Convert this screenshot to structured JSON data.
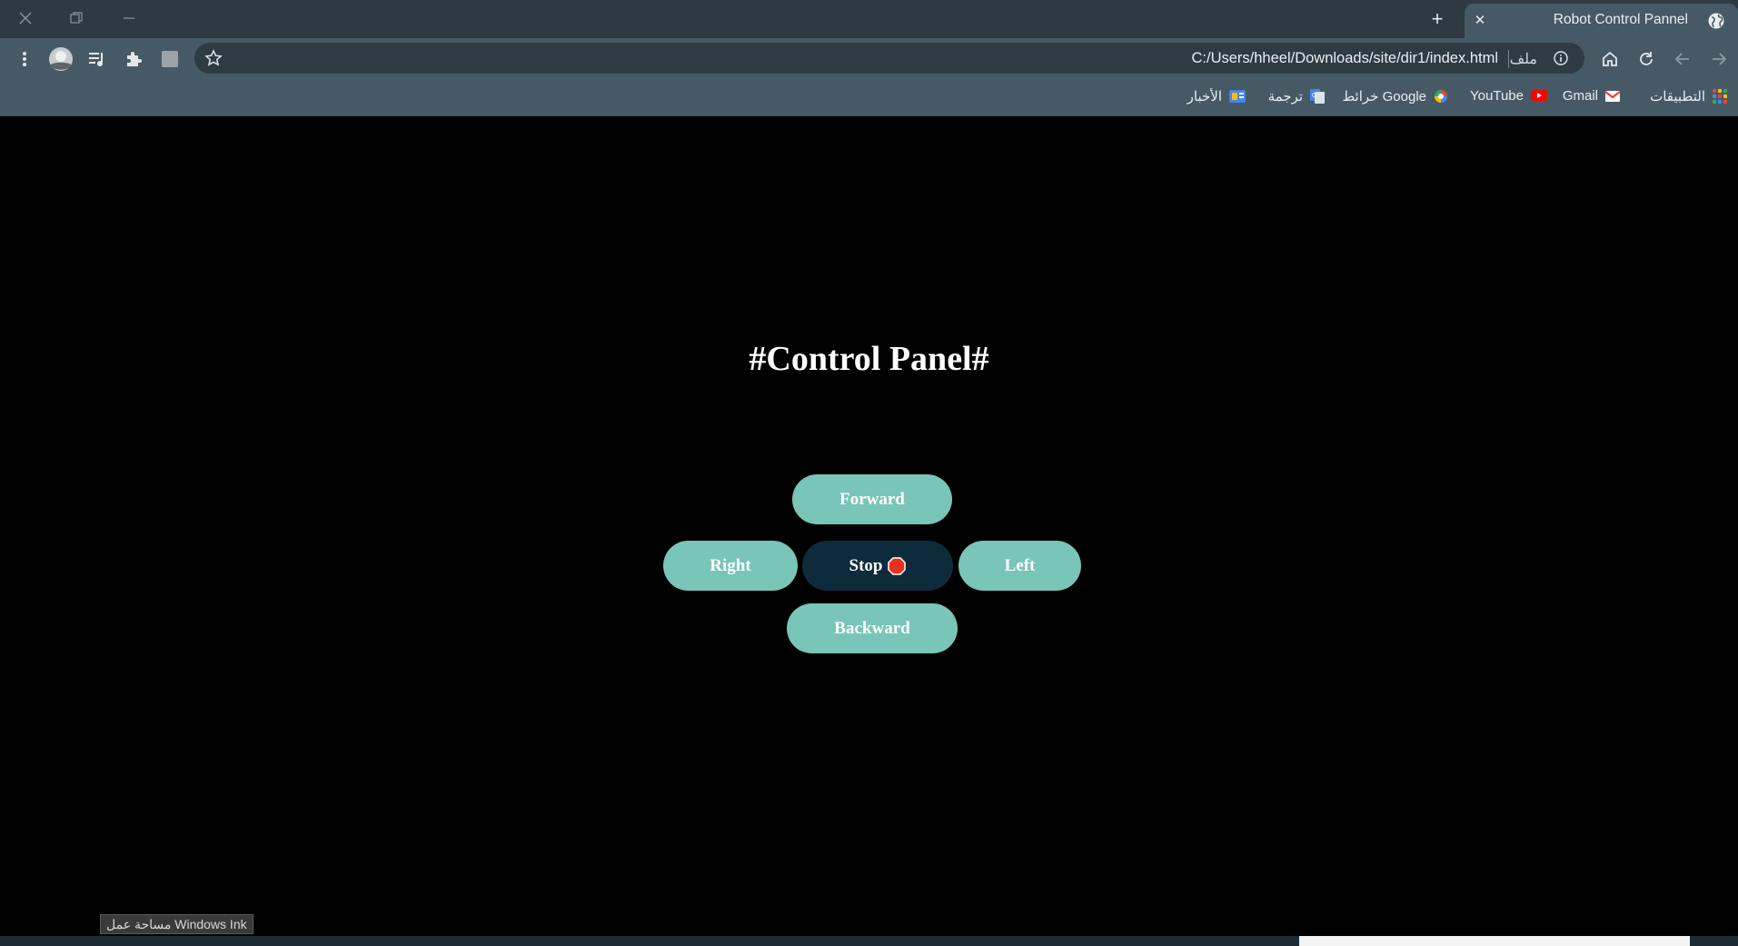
{
  "window": {
    "controls": {
      "close_icon": "close-icon",
      "restore_icon": "restore-icon",
      "minimize_icon": "minimize-icon"
    }
  },
  "tab": {
    "title": "Robot Control Pannel",
    "icon": "globe-icon",
    "close_label": "✕"
  },
  "new_tab": {
    "label": "+"
  },
  "toolbar": {
    "url": "C:/Users/hheel/Downloads/site/dir1/index.html",
    "scheme_label": "ملف",
    "icons": [
      "menu-icon",
      "profile-avatar",
      "media-queue-icon",
      "extensions-icon",
      "extension-app-icon",
      "star-icon",
      "home-icon",
      "reload-icon",
      "back-icon",
      "forward-icon"
    ]
  },
  "bookmarks": [
    {
      "label": "التطبيقات",
      "icon": "apps-grid-icon"
    },
    {
      "label": "Gmail",
      "icon": "gmail-icon"
    },
    {
      "label": "YouTube",
      "icon": "youtube-icon"
    },
    {
      "label": "خرائط Google",
      "icon": "maps-icon"
    },
    {
      "label": "ترجمة",
      "icon": "translate-icon"
    },
    {
      "label": "الأخبار",
      "icon": "news-icon"
    }
  ],
  "page": {
    "heading": "#Control Panel#",
    "buttons": {
      "forward": "Forward",
      "right": "Right",
      "stop": "Stop",
      "left": "Left",
      "backward": "Backward"
    },
    "stop_icon": "stop-sign-icon"
  },
  "tooltip": {
    "text": "مساحة عمل Windows Ink"
  },
  "colors": {
    "button": "#79c5b7",
    "stop_button": "#0e2b3c",
    "stop_sign": "#e8321f",
    "tab_bg": "#465a65",
    "titlebar_bg": "#2d3a42"
  }
}
